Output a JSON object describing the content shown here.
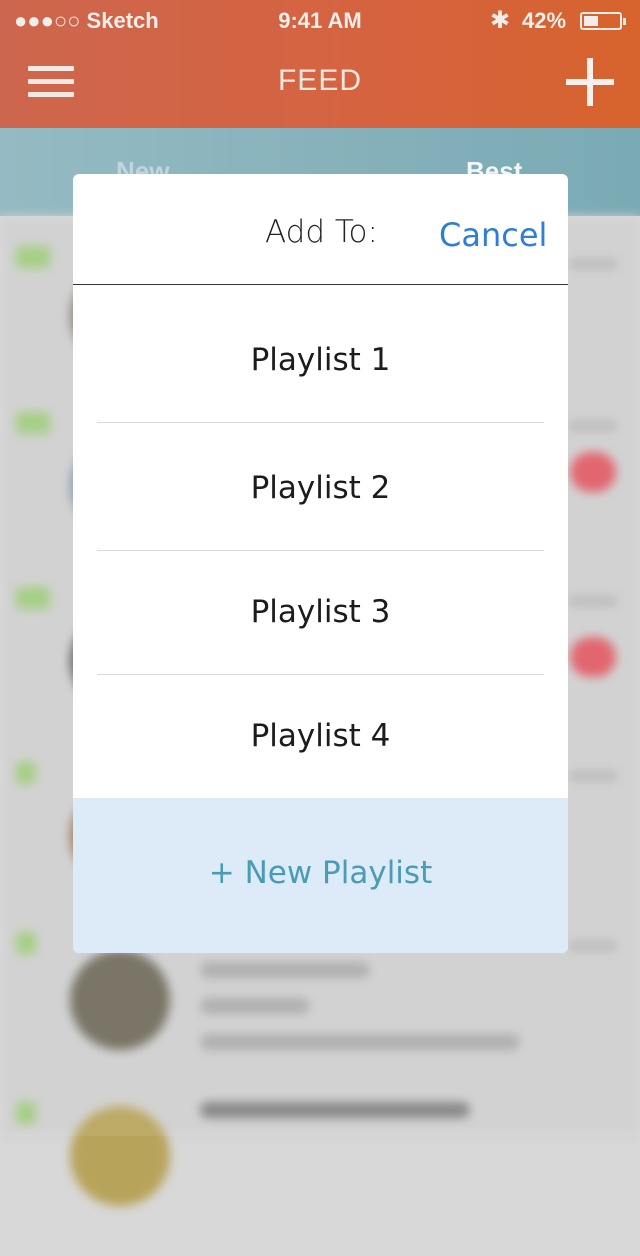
{
  "status_bar": {
    "carrier": "●●●○○ Sketch",
    "time": "9:41 AM",
    "battery_percent": "42%",
    "battery_level": 0.42
  },
  "nav": {
    "title": "FEED",
    "menu_icon": "hamburger-icon",
    "add_icon": "plus-icon"
  },
  "tabs": [
    {
      "label": "New"
    },
    {
      "label": "Best"
    }
  ],
  "modal": {
    "title": "Add To:",
    "cancel_label": "Cancel",
    "playlists": [
      {
        "label": "Playlist 1"
      },
      {
        "label": "Playlist 2"
      },
      {
        "label": "Playlist 3"
      },
      {
        "label": "Playlist 4"
      }
    ],
    "new_playlist_label": "+ New Playlist"
  },
  "colors": {
    "header": "#d3562f",
    "tabs": "#7aabb5",
    "accent": "#2e7ed8",
    "new_playlist_bg": "#ddebf8",
    "new_playlist_text": "#4a9bb4"
  }
}
